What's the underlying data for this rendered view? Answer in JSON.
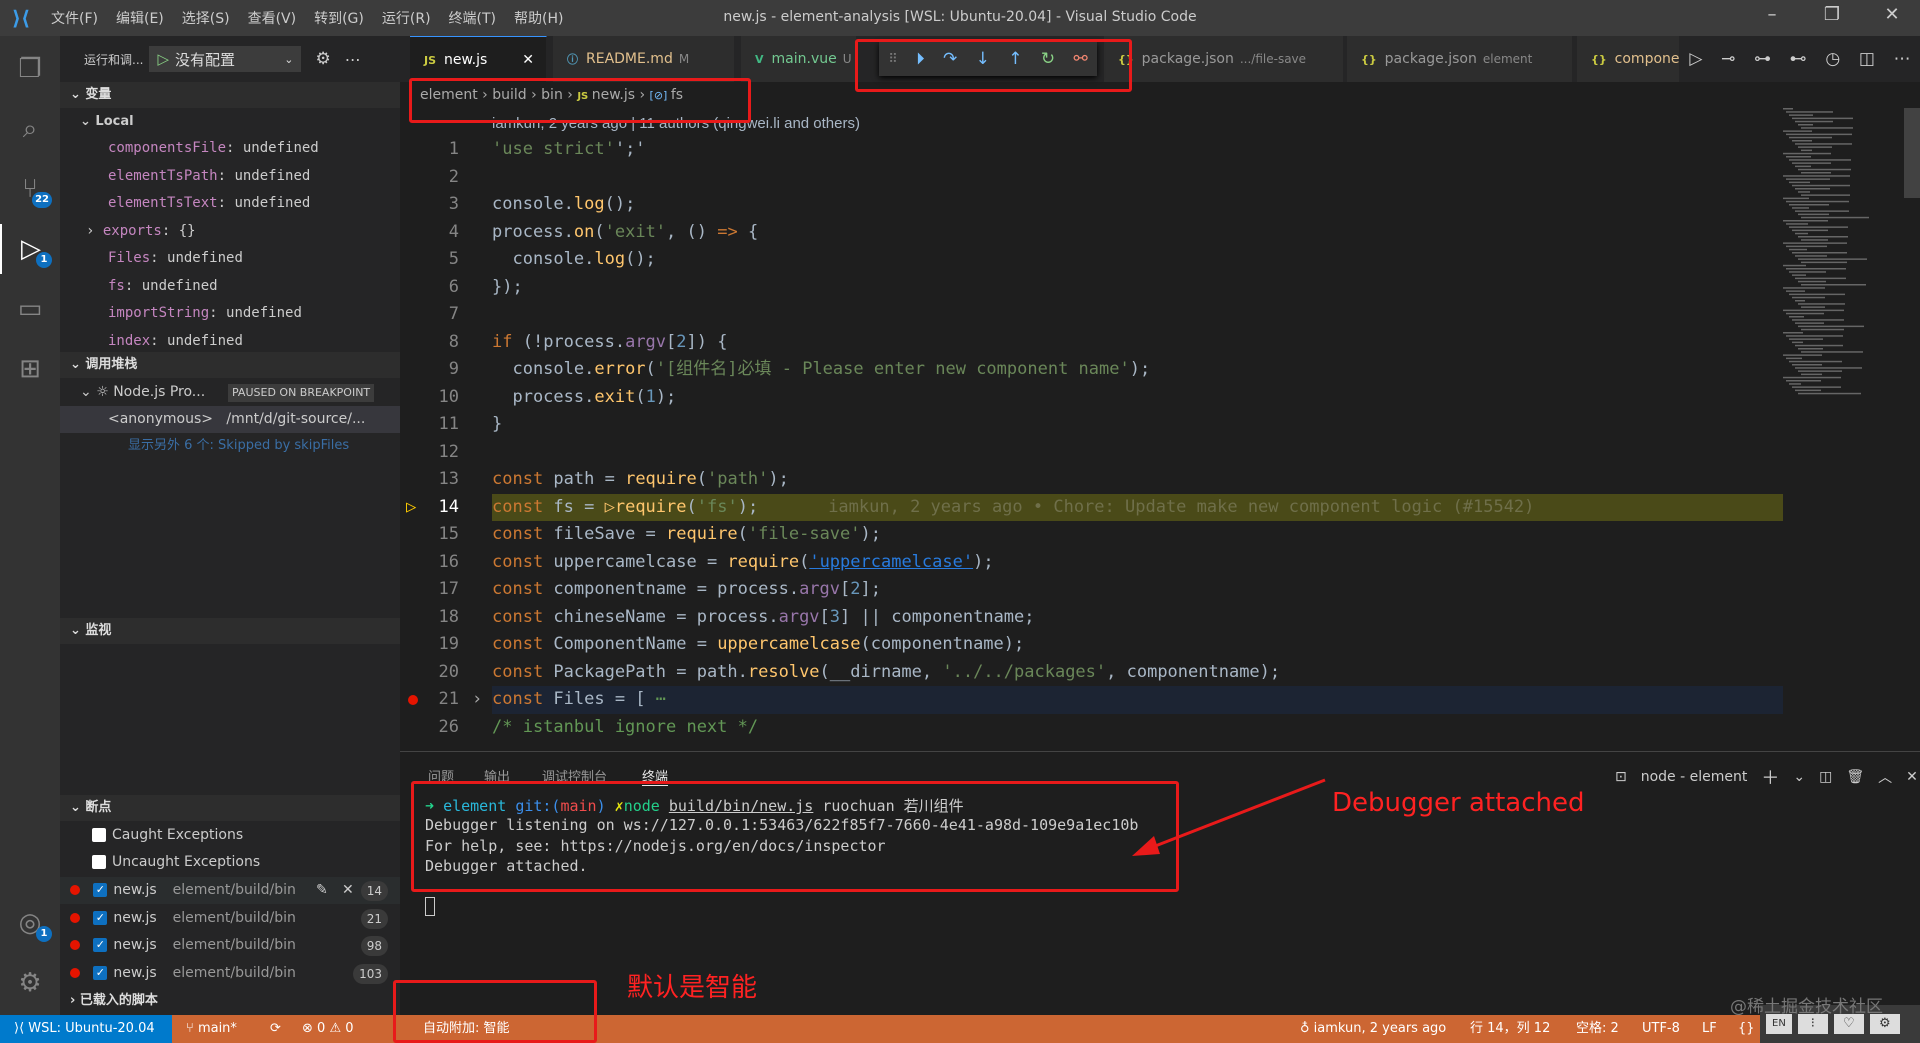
{
  "titlebar": {
    "title": "new.js - element-analysis [WSL: Ubuntu-20.04] - Visual Studio Code",
    "menus": [
      "文件(F)",
      "编辑(E)",
      "选择(S)",
      "查看(V)",
      "转到(G)",
      "运行(R)",
      "终端(T)",
      "帮助(H)"
    ]
  },
  "activity": {
    "scm_badge": "22",
    "debug_badge": "1",
    "account_badge": "1"
  },
  "sidebar": {
    "view_title": "运行和调...",
    "config": "没有配置",
    "variables": {
      "title": "变量",
      "scope": "Local",
      "items": [
        {
          "name": "componentsFile",
          "value": "undefined"
        },
        {
          "name": "elementTsPath",
          "value": "undefined"
        },
        {
          "name": "elementTsText",
          "value": "undefined"
        },
        {
          "name": "exports",
          "value": "{}"
        },
        {
          "name": "Files",
          "value": "undefined"
        },
        {
          "name": "fs",
          "value": "undefined"
        },
        {
          "name": "importString",
          "value": "undefined"
        },
        {
          "name": "index",
          "value": "undefined"
        }
      ]
    },
    "callstack": {
      "title": "调用堆栈",
      "session": "Node.js Pro...",
      "status": "PAUSED ON BREAKPOINT",
      "frame": "<anonymous>",
      "frame_path": "/mnt/d/git-source/...",
      "skipped": "显示另外 6 个: Skipped by skipFiles"
    },
    "watch": {
      "title": "监视"
    },
    "breakpoints": {
      "title": "断点",
      "caught": "Caught Exceptions",
      "uncaught": "Uncaught Exceptions",
      "items": [
        {
          "file": "new.js",
          "path": "element/build/bin",
          "line": "14"
        },
        {
          "file": "new.js",
          "path": "element/build/bin",
          "line": "21"
        },
        {
          "file": "new.js",
          "path": "element/build/bin",
          "line": "98"
        },
        {
          "file": "new.js",
          "path": "element/build/bin",
          "line": "103"
        }
      ]
    },
    "loaded_scripts": {
      "title": "已载入的脚本"
    }
  },
  "tabs": [
    {
      "label": "new.js",
      "icon": "JS",
      "sub": ""
    },
    {
      "label": "README.md",
      "icon": "ⓘ",
      "sub": "M"
    },
    {
      "label": "main.vue",
      "icon": "V",
      "sub": "U"
    },
    {
      "label": "package.json",
      "icon": "{}",
      "sub": ".../file-save"
    },
    {
      "label": "package.json",
      "icon": "{}",
      "sub": "element"
    },
    {
      "label": "compone",
      "icon": "{}",
      "sub": ""
    }
  ],
  "breadcrumb": [
    "element",
    "build",
    "bin",
    "new.js",
    "fs"
  ],
  "editor": {
    "blame_header": "iamkun, 2 years ago | 11 authors (qingwei.li and others)",
    "inline_blame": "iamkun, 2 years ago • Chore: Update make new component logic (#15542)",
    "lines": [
      {
        "n": "1",
        "t": [
          [
            "s",
            "'use strict'"
          ],
          [
            "",
            "';'"
          ]
        ]
      },
      {
        "n": "2",
        "t": []
      },
      {
        "n": "3",
        "t": [
          [
            "",
            "console."
          ],
          [
            "f",
            "log"
          ],
          [
            "",
            "();"
          ]
        ]
      },
      {
        "n": "4",
        "t": [
          [
            "",
            "process."
          ],
          [
            "f",
            "on"
          ],
          [
            "",
            "("
          ],
          [
            "s",
            "'exit'"
          ],
          [
            "",
            ", () "
          ],
          [
            "k",
            "=>"
          ],
          [
            "",
            " {"
          ]
        ]
      },
      {
        "n": "5",
        "t": [
          [
            "",
            "  console."
          ],
          [
            "f",
            "log"
          ],
          [
            "",
            "();"
          ]
        ]
      },
      {
        "n": "6",
        "t": [
          [
            "",
            "});"
          ]
        ]
      },
      {
        "n": "7",
        "t": []
      },
      {
        "n": "8",
        "t": [
          [
            "k",
            "if"
          ],
          [
            "",
            " (!process."
          ],
          [
            "p",
            "argv"
          ],
          [
            "",
            "["
          ],
          [
            "n",
            "2"
          ],
          [
            "",
            "]) {"
          ]
        ]
      },
      {
        "n": "9",
        "t": [
          [
            "",
            "  console."
          ],
          [
            "f",
            "error"
          ],
          [
            "",
            "("
          ],
          [
            "s",
            "'[组件名]必填 - Please enter new component name'"
          ],
          [
            "",
            ");"
          ]
        ]
      },
      {
        "n": "10",
        "t": [
          [
            "",
            "  process."
          ],
          [
            "f",
            "exit"
          ],
          [
            "",
            "("
          ],
          [
            "n",
            "1"
          ],
          [
            "",
            ");"
          ]
        ]
      },
      {
        "n": "11",
        "t": [
          [
            "",
            "}"
          ]
        ]
      },
      {
        "n": "12",
        "t": []
      },
      {
        "n": "13",
        "t": [
          [
            "k",
            "const"
          ],
          [
            "",
            " path = "
          ],
          [
            "f",
            "require"
          ],
          [
            "",
            "("
          ],
          [
            "s",
            "'path'"
          ],
          [
            "",
            ");"
          ]
        ]
      },
      {
        "n": "14",
        "t": [
          [
            "k",
            "const"
          ],
          [
            "",
            " fs = "
          ],
          [
            "f",
            "▷require"
          ],
          [
            "",
            "("
          ],
          [
            "s",
            "'fs'"
          ],
          [
            "",
            ");"
          ]
        ]
      },
      {
        "n": "15",
        "t": [
          [
            "k",
            "const"
          ],
          [
            "",
            " fileSave = "
          ],
          [
            "f",
            "require"
          ],
          [
            "",
            "("
          ],
          [
            "s",
            "'file-save'"
          ],
          [
            "",
            ");"
          ]
        ]
      },
      {
        "n": "16",
        "t": [
          [
            "k",
            "const"
          ],
          [
            "",
            " uppercamelcase = "
          ],
          [
            "f",
            "require"
          ],
          [
            "",
            "("
          ],
          [
            "u",
            "'uppercamelcase'"
          ],
          [
            "",
            ");"
          ]
        ]
      },
      {
        "n": "17",
        "t": [
          [
            "k",
            "const"
          ],
          [
            "",
            " componentname = process."
          ],
          [
            "p",
            "argv"
          ],
          [
            "",
            "["
          ],
          [
            "n",
            "2"
          ],
          [
            "",
            "];"
          ]
        ]
      },
      {
        "n": "18",
        "t": [
          [
            "k",
            "const"
          ],
          [
            "",
            " chineseName = process."
          ],
          [
            "p",
            "argv"
          ],
          [
            "",
            "["
          ],
          [
            "n",
            "3"
          ],
          [
            "",
            "] || componentname;"
          ]
        ]
      },
      {
        "n": "19",
        "t": [
          [
            "k",
            "const"
          ],
          [
            "",
            " ComponentName = "
          ],
          [
            "f",
            "uppercamelcase"
          ],
          [
            "",
            "(componentname);"
          ]
        ]
      },
      {
        "n": "20",
        "t": [
          [
            "k",
            "const"
          ],
          [
            "",
            " PackagePath = path."
          ],
          [
            "f",
            "resolve"
          ],
          [
            "",
            "(__dirname, "
          ],
          [
            "s",
            "'../../packages'"
          ],
          [
            "",
            ", componentname);"
          ]
        ]
      },
      {
        "n": "21",
        "t": [
          [
            "k",
            "const"
          ],
          [
            "",
            " Files = [ "
          ],
          [
            "c",
            "⋯"
          ]
        ]
      },
      {
        "n": "26",
        "t": [
          [
            "c",
            "/* istanbul ignore next */"
          ]
        ]
      }
    ]
  },
  "panel": {
    "tabs": [
      "问题",
      "输出",
      "调试控制台",
      "终端"
    ],
    "terminal_name": "node - element",
    "prompt": {
      "arrow": "➜",
      "dir": "element",
      "git": "git:(",
      "branch": "main",
      "git_close": ")",
      "dirty": "✗",
      "cmd": "node",
      "file": "build/bin/new.js",
      "args": "ruochuan 若川组件"
    },
    "output": [
      "Debugger listening on ws://127.0.0.1:53463/622f85f7-7660-4e41-a98d-109e9a1ec10b",
      "For help, see: https://nodejs.org/en/docs/inspector",
      "Debugger attached."
    ]
  },
  "status": {
    "remote": "WSL: Ubuntu-20.04",
    "branch": "main*",
    "errors": "0",
    "warnings": "0",
    "auto_attach": "自动附加: 智能",
    "blame": "iamkun, 2 years ago",
    "position": "行 14，列 12",
    "indent": "空格: 2",
    "encoding": "UTF-8",
    "eol": "LF",
    "lang": "{}",
    "ime": "EN"
  },
  "annotations": {
    "debugger_attached": "Debugger attached",
    "auto_attach_note": "默认是智能",
    "color": "#e81a1a"
  },
  "watermark": "@稀土掘金技术社区",
  "colors": {
    "status_bar": "#cc6633",
    "remote": "#007acc",
    "current_line": "#4a4a18",
    "breakpoint": "#e51400"
  }
}
